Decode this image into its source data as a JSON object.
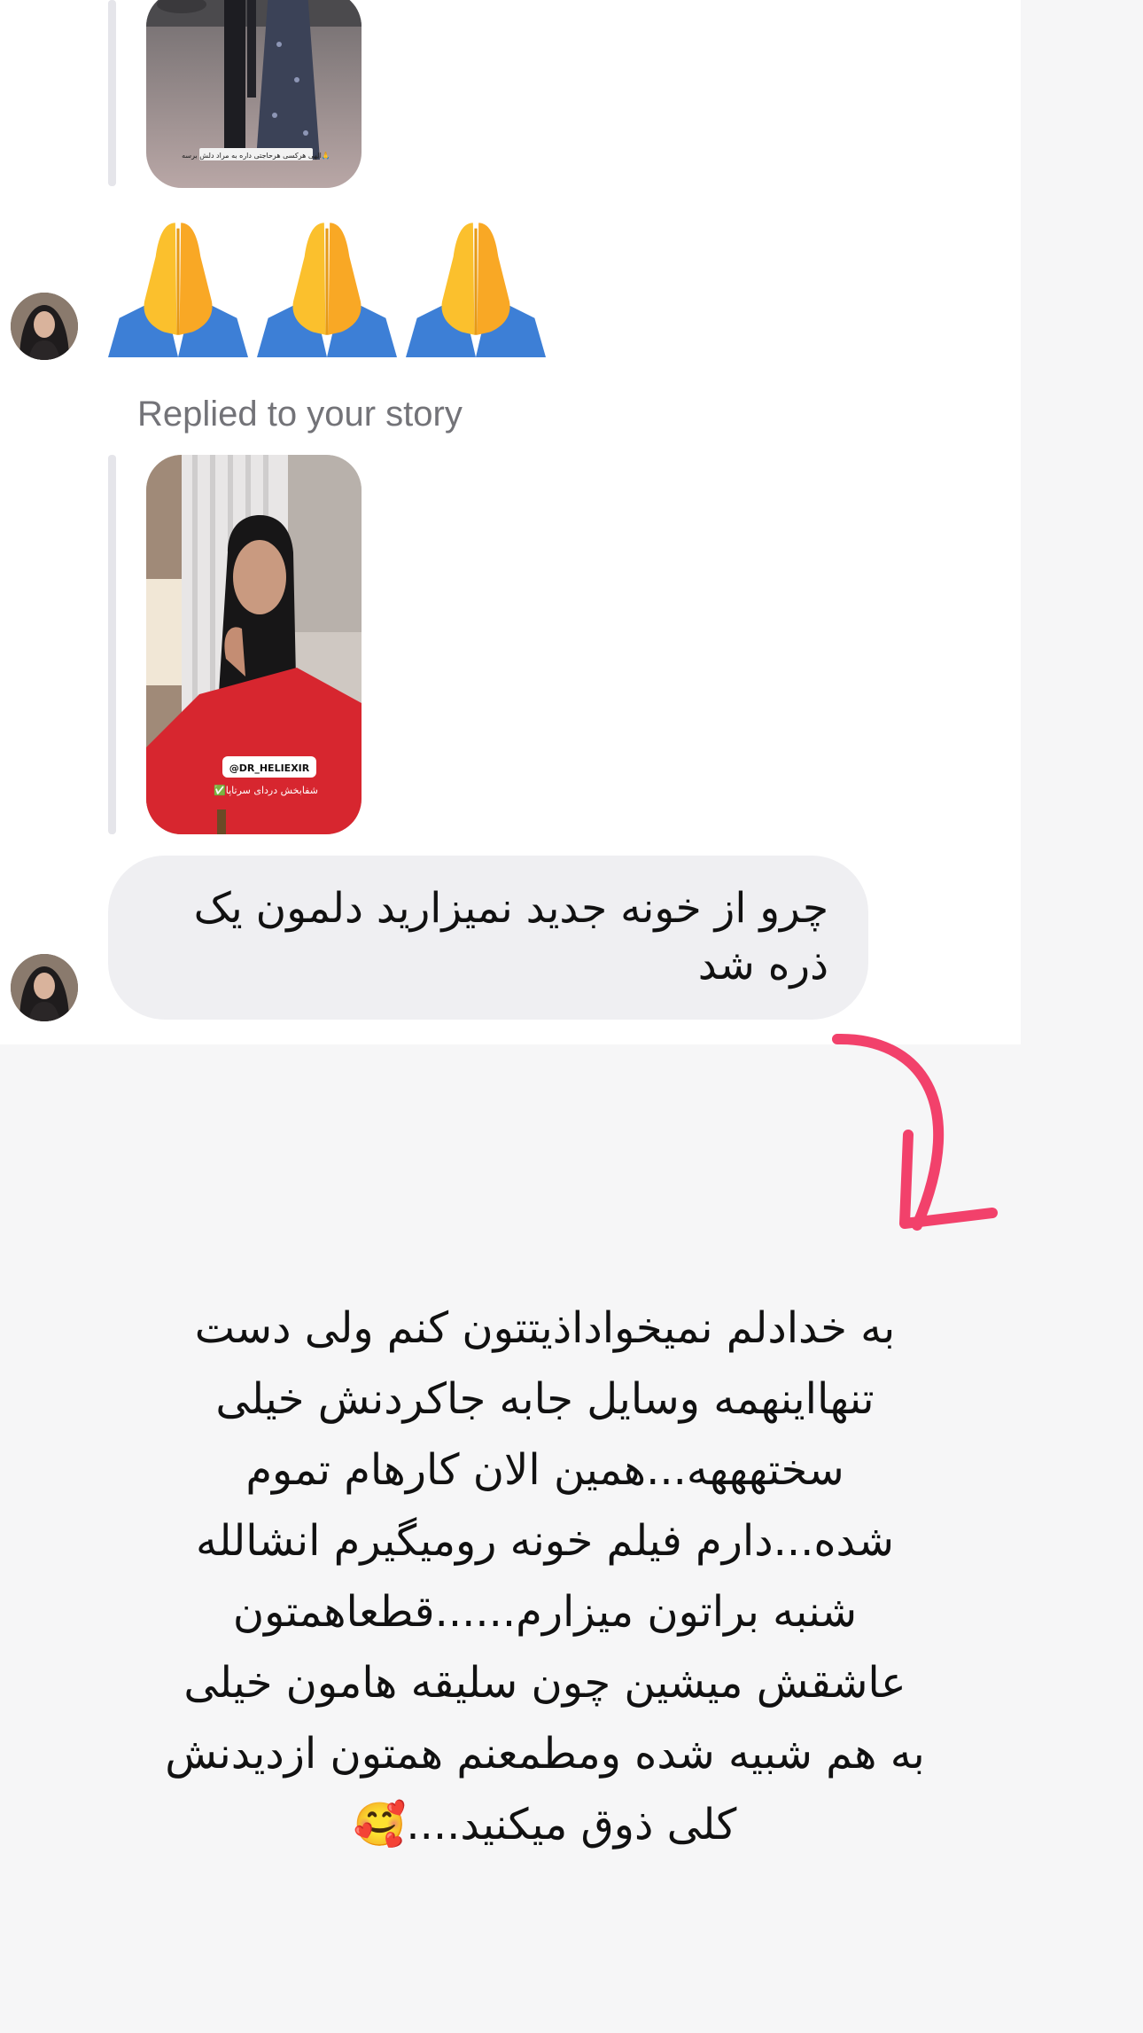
{
  "thread": {
    "first_story_overlay_text": "الهی هرکسی هر‌حاجتی داره به مراد دلش برسه🙏",
    "reaction_emojis": [
      "🙏",
      "🙏",
      "🙏"
    ],
    "reply_label": "Replied to your story",
    "second_story_tag": "@DR_HELIEXIR",
    "second_story_subtitle": "✅شفابخش دردای سرتاپا",
    "message_text": "چرو از خونه جدید نمیزارید دلمون یک ذره شد",
    "reply_avatar_icon": "avatar-woman-hijab",
    "accent_color": "#f2416b"
  },
  "caption": {
    "lines": [
      "به خدادلم نمیخواداذیتتون کنم ولی دست",
      "تنهااینهمه وسایل جابه جاکردنش خیلی",
      "سختهههه...همین الان کارهام تموم",
      "شده...دارم فیلم خونه رومیگیرم انشالله",
      "شنبه براتون میزارم......قطعاهمتون",
      "عاشقش میشین چون سلیقه هامون خیلی",
      "به هم شبیه شده ومطمعنم همتون ازدیدنش",
      "کلی ذوق میکنید....🥰"
    ]
  }
}
